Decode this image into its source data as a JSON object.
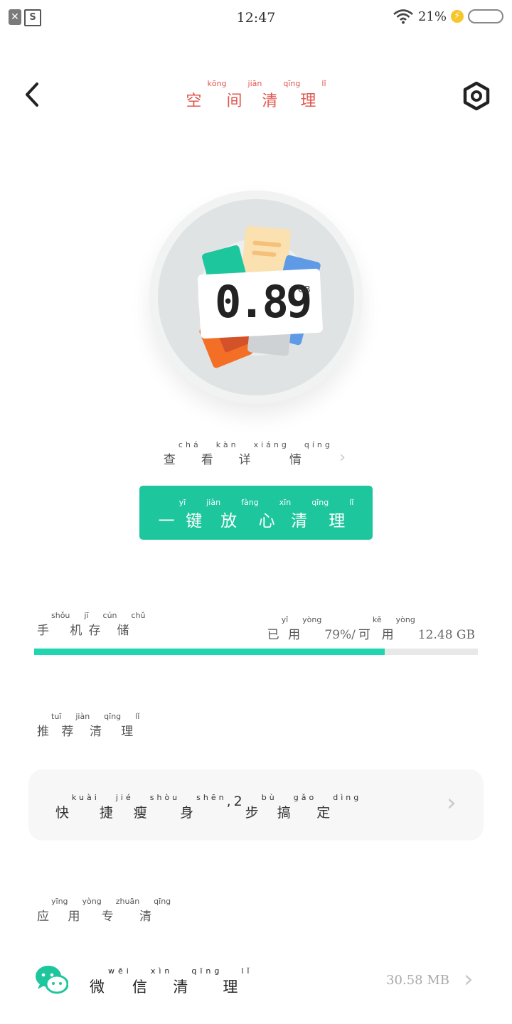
{
  "status_bar": {
    "time": "12:47",
    "battery_percent": "21%",
    "left_icons": [
      "close-box-icon",
      "screenshot-s-icon"
    ]
  },
  "header": {
    "title": [
      {
        "char": "空",
        "pinyin": "kōng"
      },
      {
        "char": "间",
        "pinyin": "jiān"
      },
      {
        "char": "清",
        "pinyin": "qīng"
      },
      {
        "char": "理",
        "pinyin": "lǐ"
      }
    ]
  },
  "junk": {
    "value": "0.89",
    "unit": "GB"
  },
  "view_details": [
    {
      "char": "查",
      "pinyin": "chá"
    },
    {
      "char": "看",
      "pinyin": "kàn"
    },
    {
      "char": "详",
      "pinyin": "xiáng"
    },
    {
      "char": "情",
      "pinyin": "qíng"
    }
  ],
  "main_button": [
    {
      "char": "一",
      "pinyin": "yī"
    },
    {
      "char": "键",
      "pinyin": "jiàn"
    },
    {
      "char": "放",
      "pinyin": "fàng"
    },
    {
      "char": "心",
      "pinyin": "xīn"
    },
    {
      "char": "清",
      "pinyin": "qīng"
    },
    {
      "char": "理",
      "pinyin": "lǐ"
    }
  ],
  "storage": {
    "label": [
      {
        "char": "手",
        "pinyin": "shǒu"
      },
      {
        "char": "机",
        "pinyin": "jī"
      },
      {
        "char": "存",
        "pinyin": "cún"
      },
      {
        "char": "储",
        "pinyin": "chǔ"
      }
    ],
    "used_label": [
      {
        "char": "已",
        "pinyin": "yǐ"
      },
      {
        "char": "用",
        "pinyin": "yòng"
      }
    ],
    "used_percent_text": "79%/",
    "available_label": [
      {
        "char": "可",
        "pinyin": "kě"
      },
      {
        "char": "用",
        "pinyin": "yòng"
      }
    ],
    "available_text": "12.48 GB",
    "used_fraction": 0.79,
    "bar_color": "#1fd6b0"
  },
  "recommend": {
    "label": [
      {
        "char": "推",
        "pinyin": "tuī"
      },
      {
        "char": "荐",
        "pinyin": "jiàn"
      },
      {
        "char": "清",
        "pinyin": "qīng"
      },
      {
        "char": "理",
        "pinyin": "lǐ"
      }
    ],
    "card_text": [
      {
        "char": "快",
        "pinyin": "kuài"
      },
      {
        "char": "捷",
        "pinyin": "jié"
      },
      {
        "char": "瘦",
        "pinyin": "shòu"
      },
      {
        "char": "身",
        "pinyin": "shēn"
      },
      {
        "char": ",",
        "pinyin": ""
      },
      {
        "char": "2",
        "pinyin": ""
      },
      {
        "char": "步",
        "pinyin": "bù"
      },
      {
        "char": "搞",
        "pinyin": "gǎo"
      },
      {
        "char": "定",
        "pinyin": "dìng"
      }
    ]
  },
  "app_clean": {
    "label": [
      {
        "char": "应",
        "pinyin": "yīng"
      },
      {
        "char": "用",
        "pinyin": "yòng"
      },
      {
        "char": "专",
        "pinyin": "zhuān"
      },
      {
        "char": "清",
        "pinyin": "qīng"
      }
    ],
    "wechat_label": [
      {
        "char": "微",
        "pinyin": "wēi"
      },
      {
        "char": "信",
        "pinyin": "xìn"
      },
      {
        "char": "清",
        "pinyin": "qīng"
      },
      {
        "char": "理",
        "pinyin": "lǐ"
      }
    ],
    "wechat_size": "30.58 MB",
    "wechat_color": "#1dc69d"
  },
  "accent_color": "#1dc69d",
  "title_color": "#e0564e"
}
